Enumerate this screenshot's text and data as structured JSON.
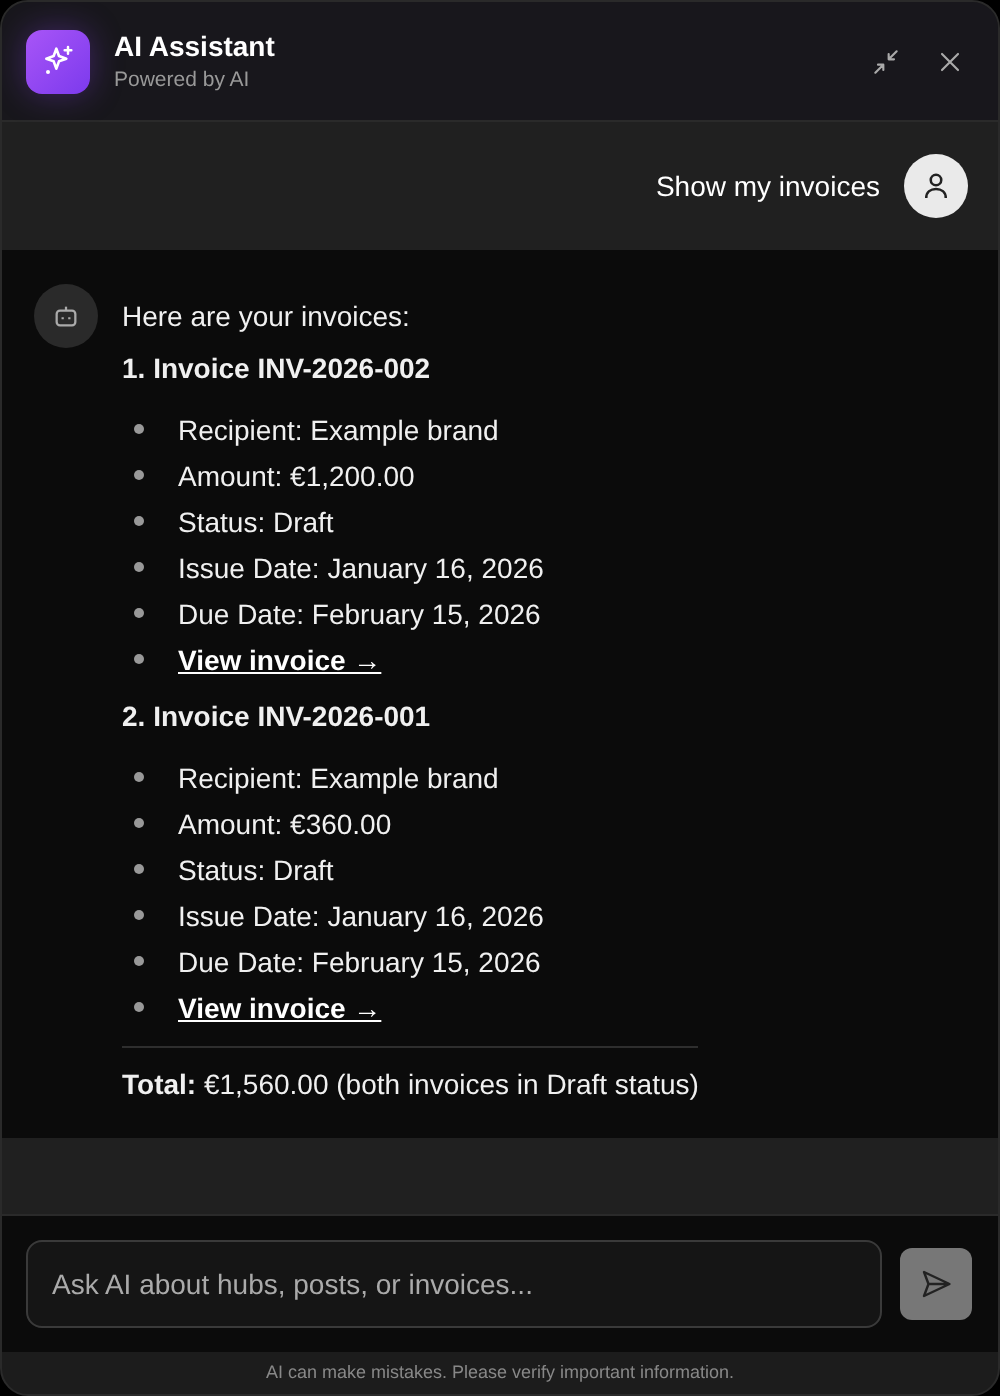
{
  "header": {
    "title": "AI Assistant",
    "subtitle": "Powered by AI"
  },
  "messages": [
    {
      "kind": "user",
      "text": "Show my invoices"
    },
    {
      "kind": "assistant",
      "intro": "Here are your invoices:",
      "invoices": [
        {
          "heading": "1. Invoice INV-2026-002",
          "details": [
            "Recipient: Example brand",
            "Amount: €1,200.00",
            "Status: Draft",
            "Issue Date: January 16, 2026",
            "Due Date: February 15, 2026"
          ],
          "link": "View invoice →"
        },
        {
          "heading": "2. Invoice INV-2026-001",
          "details": [
            "Recipient: Example brand",
            "Amount: €360.00",
            "Status: Draft",
            "Issue Date: January 16, 2026",
            "Due Date: February 15, 2026"
          ],
          "link": "View invoice →"
        }
      ],
      "total": "**Total:** €1,560.00 (both invoices in Draft status)"
    }
  ],
  "input": {
    "placeholder": "Ask AI about hubs, posts, or invoices..."
  },
  "disclaimer": "AI can make mistakes. Please verify important information."
}
